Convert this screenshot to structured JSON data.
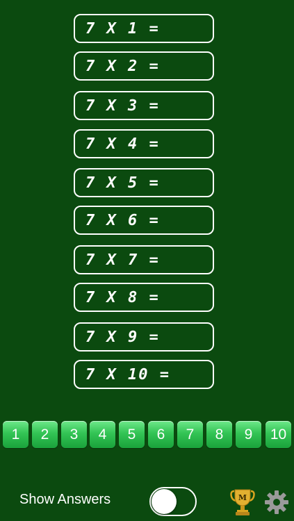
{
  "equations": [
    {
      "label": "7 X 1 ="
    },
    {
      "label": "7 X 2 ="
    },
    {
      "label": "7 X 3 ="
    },
    {
      "label": "7 X 4 ="
    },
    {
      "label": "7 X 5 ="
    },
    {
      "label": "7 X 6 ="
    },
    {
      "label": "7 X 7 ="
    },
    {
      "label": "7 X 8 ="
    },
    {
      "label": "7 X 9 ="
    },
    {
      "label": "7 X 10 ="
    }
  ],
  "numbers": [
    "1",
    "2",
    "3",
    "4",
    "5",
    "6",
    "7",
    "8",
    "9",
    "10"
  ],
  "footer": {
    "show_answers_label": "Show Answers",
    "show_answers_on": false,
    "trophy_letter": "M",
    "trophy_icon": "trophy-icon",
    "settings_icon": "gear-icon"
  },
  "colors": {
    "background": "#0b4a0f",
    "button_green": "#33c455",
    "trophy_gold": "#d9a520",
    "gear_gray": "#9a9a9a"
  }
}
